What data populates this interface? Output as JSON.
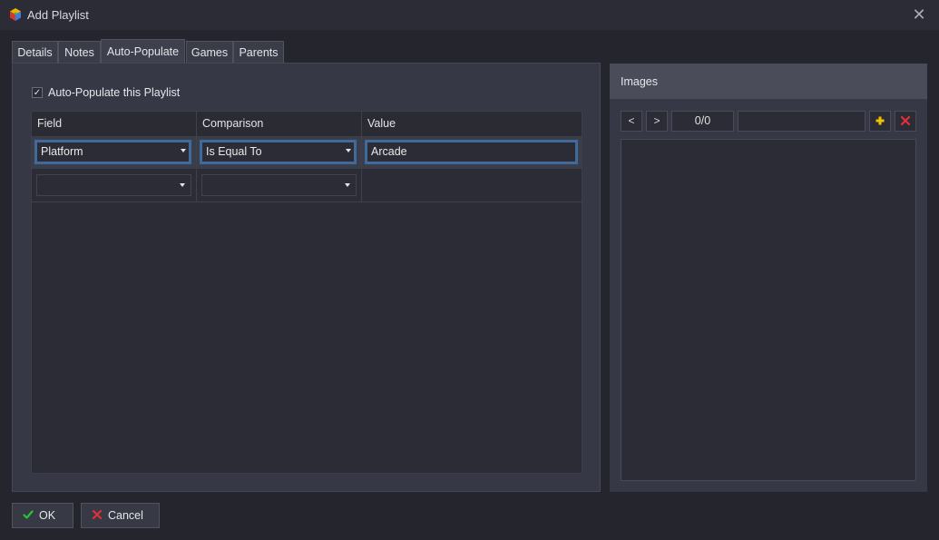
{
  "window": {
    "title": "Add Playlist",
    "app_icon": "app-logo-icon",
    "close_icon": "close-icon"
  },
  "tabs": [
    {
      "label": "Details"
    },
    {
      "label": "Notes"
    },
    {
      "label": "Auto-Populate",
      "active": true
    },
    {
      "label": "Games"
    },
    {
      "label": "Parents"
    }
  ],
  "auto_populate": {
    "checkbox_label": "Auto-Populate this Playlist",
    "checked": true,
    "columns": [
      "Field",
      "Comparison",
      "Value"
    ],
    "rows": [
      {
        "field": "Platform",
        "comparison": "Is Equal To",
        "value": "Arcade"
      },
      {
        "field": "",
        "comparison": "",
        "value": ""
      }
    ]
  },
  "images_panel": {
    "title": "Images",
    "prev_label": "<",
    "next_label": ">",
    "counter": "0/0",
    "add_icon": "plus-icon",
    "remove_icon": "red-x-icon"
  },
  "footer": {
    "ok_label": "OK",
    "cancel_label": "Cancel"
  },
  "colors": {
    "accent": "#3f6a9a",
    "panel": "#363845",
    "ok_check": "#27c33d",
    "cancel_x": "#e0303a",
    "add_plus": "#f2c200"
  }
}
